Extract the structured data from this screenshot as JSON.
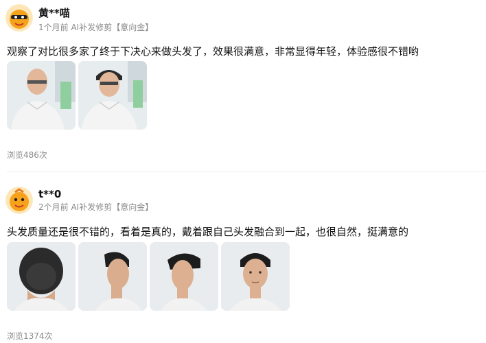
{
  "reviews": [
    {
      "user": "黄**喵",
      "meta": "1个月前 AI补发修剪【意向金】",
      "text": "观察了对比很多家了终于下决心来做头发了，效果很满意，非常显得年轻，体验感很不错哟",
      "photos": [
        "photo-man-front-1",
        "photo-man-front-2"
      ],
      "views": "浏览486次"
    },
    {
      "user": "t**0",
      "meta": "2个月前 AI补发修剪【意向金】",
      "text": "头发质量还是很不错的，看着是真的，戴着跟自己头发融合到一起，也很自然，挺满意的",
      "photos": [
        "photo-head-top",
        "photo-side-1",
        "photo-side-2",
        "photo-front"
      ],
      "views": "浏览1374次"
    }
  ],
  "colors": {
    "accent": "#f7a21b",
    "muted": "#8a8a8a"
  }
}
